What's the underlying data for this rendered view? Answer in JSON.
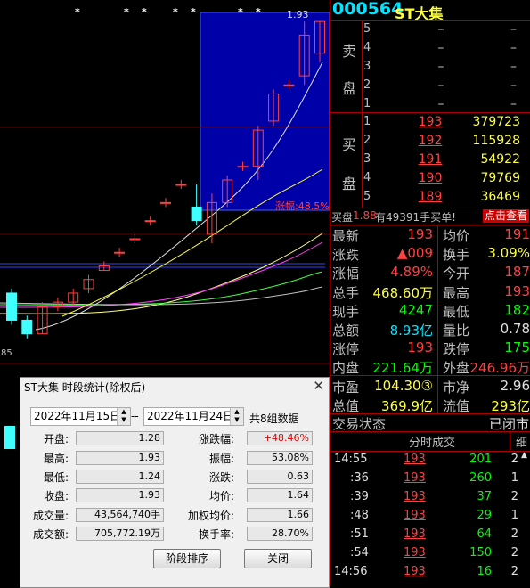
{
  "chart": {
    "markers": [
      "*",
      "*",
      "*",
      "*",
      "*",
      "*",
      "*",
      "*"
    ],
    "high_label": "1.93",
    "range_label": "涨幅:48.5%",
    "low_label": "85",
    "candles": [
      {
        "o": 1.27,
        "c": 1.33,
        "h": 1.34,
        "l": 1.26,
        "up": false
      },
      {
        "o": 1.27,
        "c": 1.24,
        "h": 1.28,
        "l": 1.23,
        "up": false
      },
      {
        "o": 1.24,
        "c": 1.3,
        "h": 1.31,
        "l": 1.24,
        "up": true
      },
      {
        "o": 1.3,
        "c": 1.31,
        "h": 1.32,
        "l": 1.29,
        "up": true
      },
      {
        "o": 1.31,
        "c": 1.33,
        "h": 1.34,
        "l": 1.3,
        "up": true
      },
      {
        "o": 1.34,
        "c": 1.36,
        "h": 1.37,
        "l": 1.33,
        "up": true
      },
      {
        "o": 1.38,
        "c": 1.39,
        "h": 1.4,
        "l": 1.38,
        "up": true
      },
      {
        "o": 1.42,
        "c": 1.42,
        "h": 1.43,
        "l": 1.41,
        "up": true
      },
      {
        "o": 1.45,
        "c": 1.45,
        "h": 1.46,
        "l": 1.44,
        "up": true
      },
      {
        "o": 1.49,
        "c": 1.49,
        "h": 1.5,
        "l": 1.48,
        "up": true
      },
      {
        "o": 1.53,
        "c": 1.53,
        "h": 1.54,
        "l": 1.52,
        "up": true
      },
      {
        "o": 1.57,
        "c": 1.57,
        "h": 1.58,
        "l": 1.56,
        "up": true
      },
      {
        "o": 1.52,
        "c": 1.49,
        "h": 1.57,
        "l": 1.48,
        "up": false
      },
      {
        "o": 1.46,
        "c": 1.53,
        "h": 1.55,
        "l": 1.44,
        "up": true
      },
      {
        "o": 1.53,
        "c": 1.58,
        "h": 1.59,
        "l": 1.52,
        "up": true
      },
      {
        "o": 1.61,
        "c": 1.61,
        "h": 1.62,
        "l": 1.6,
        "up": true
      },
      {
        "o": 1.61,
        "c": 1.69,
        "h": 1.7,
        "l": 1.58,
        "up": true
      },
      {
        "o": 1.71,
        "c": 1.77,
        "h": 1.78,
        "l": 1.7,
        "up": true
      },
      {
        "o": 1.79,
        "c": 1.79,
        "h": 1.8,
        "l": 1.78,
        "up": true
      },
      {
        "o": 1.81,
        "c": 1.9,
        "h": 1.93,
        "l": 1.79,
        "up": true
      },
      {
        "o": 1.86,
        "c": 1.93,
        "h": 1.93,
        "l": 1.84,
        "up": true
      }
    ]
  },
  "stock": {
    "code": "000564",
    "name": "ST大集"
  },
  "orderbook": {
    "sell_side": "卖",
    "sell_side2": "盘",
    "buy_side": "买",
    "buy_side2": "盘",
    "sell": [
      {
        "lv": "5",
        "price": "–",
        "vol": "–"
      },
      {
        "lv": "4",
        "price": "–",
        "vol": "–"
      },
      {
        "lv": "3",
        "price": "–",
        "vol": "–"
      },
      {
        "lv": "2",
        "price": "–",
        "vol": "–"
      },
      {
        "lv": "1",
        "price": "–",
        "vol": "–"
      }
    ],
    "buy": [
      {
        "lv": "1",
        "price": "193",
        "vol": "379723"
      },
      {
        "lv": "2",
        "price": "192",
        "vol": "115928"
      },
      {
        "lv": "3",
        "price": "191",
        "vol": "54922"
      },
      {
        "lv": "4",
        "price": "190",
        "vol": "79769"
      },
      {
        "lv": "5",
        "price": "189",
        "vol": "36469"
      }
    ],
    "buy_info_prefix": "买盘",
    "buy_info_val": "1.88",
    "buy_info_suffix": "有49391手买单!",
    "query_btn": "点击查看"
  },
  "quote": {
    "rows": [
      {
        "l1": "最新",
        "v1": "193",
        "c1": "red",
        "l2": "均价",
        "v2": "191",
        "c2": "red"
      },
      {
        "l1": "涨跌",
        "v1": "▲009",
        "c1": "red",
        "l2": "换手",
        "v2": "3.09%",
        "c2": "yellow"
      },
      {
        "l1": "涨幅",
        "v1": "4.89%",
        "c1": "red",
        "l2": "今开",
        "v2": "187",
        "c2": "red"
      },
      {
        "l1": "总手",
        "v1": "468.60万",
        "c1": "yellow",
        "l2": "最高",
        "v2": "193",
        "c2": "red"
      },
      {
        "l1": "现手",
        "v1": "4247",
        "c1": "green",
        "l2": "最低",
        "v2": "182",
        "c2": "green"
      },
      {
        "l1": "总额",
        "v1": "8.93亿",
        "c1": "cyan",
        "l2": "量比",
        "v2": "0.78",
        "c2": "white"
      },
      {
        "l1": "涨停",
        "v1": "193",
        "c1": "red",
        "l2": "跌停",
        "v2": "175",
        "c2": "green"
      },
      {
        "l1": "内盘",
        "v1": "221.64万",
        "c1": "green",
        "l2": "外盘",
        "v2": "246.96万",
        "c2": "red"
      },
      {
        "l1": "市盈",
        "v1": "104.30③",
        "c1": "yellow",
        "l2": "市净",
        "v2": "2.96",
        "c2": "white"
      },
      {
        "l1": "总值",
        "v1": "369.9亿",
        "c1": "yellow",
        "l2": "流值",
        "v2": "293亿",
        "c2": "yellow"
      }
    ],
    "trade_status_label": "交易状态",
    "trade_status_value": "已闭市"
  },
  "ticks": {
    "header": "分时成交",
    "detail_btn": "细",
    "rows": [
      {
        "t": "14:55",
        "p": "193",
        "v": "201",
        "n": "2"
      },
      {
        "t": ":36",
        "p": "193",
        "v": "260",
        "n": "1"
      },
      {
        "t": ":39",
        "p": "193",
        "v": "37",
        "n": "2"
      },
      {
        "t": ":48",
        "p": "193",
        "v": "29",
        "n": "1"
      },
      {
        "t": ":51",
        "p": "193",
        "v": "64",
        "n": "2"
      },
      {
        "t": ":54",
        "p": "193",
        "v": "150",
        "n": "2"
      },
      {
        "t": "14:56",
        "p": "193",
        "v": "16",
        "n": "2"
      }
    ]
  },
  "dialog": {
    "title": "ST大集 时段统计(除权后)",
    "start_date": "2022年11月15日",
    "separator": "--",
    "end_date": "2022年11月24日",
    "group_count": "共8组数据",
    "fields_left": [
      {
        "label": "开盘:",
        "value": "1.28"
      },
      {
        "label": "最高:",
        "value": "1.93"
      },
      {
        "label": "最低:",
        "value": "1.24"
      },
      {
        "label": "收盘:",
        "value": "1.93"
      },
      {
        "label": "成交量:",
        "value": "43,564,740手"
      },
      {
        "label": "成交额:",
        "value": "705,772.19万"
      }
    ],
    "fields_right": [
      {
        "label": "涨跌幅:",
        "value": "+48.46%"
      },
      {
        "label": "振幅:",
        "value": "53.08%"
      },
      {
        "label": "涨跌:",
        "value": "0.63"
      },
      {
        "label": "均价:",
        "value": "1.64"
      },
      {
        "label": "加权均价:",
        "value": "1.66"
      },
      {
        "label": "换手率:",
        "value": "28.70%"
      }
    ],
    "sort_button": "阶段排序",
    "close_button": "关闭"
  }
}
